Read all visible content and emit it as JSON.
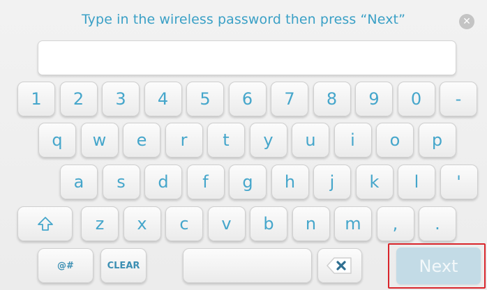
{
  "prompt": "Type in the wireless password then press “Next”",
  "close_icon": "close-icon",
  "password": {
    "value": "",
    "placeholder": ""
  },
  "keys": {
    "row1": [
      "1",
      "2",
      "3",
      "4",
      "5",
      "6",
      "7",
      "8",
      "9",
      "0",
      "-"
    ],
    "row2": [
      "q",
      "w",
      "e",
      "r",
      "t",
      "y",
      "u",
      "i",
      "o",
      "p"
    ],
    "row3": [
      "a",
      "s",
      "d",
      "f",
      "g",
      "h",
      "j",
      "k",
      "l",
      "'"
    ],
    "row4": [
      "z",
      "x",
      "c",
      "v",
      "b",
      "n",
      "m",
      ",",
      "."
    ],
    "symbols_label": "@#",
    "clear_label": "CLEAR",
    "shift_icon": "shift-arrow-icon",
    "backspace_icon": "backspace-icon"
  },
  "next_label": "Next",
  "colors": {
    "accent": "#45a6cb",
    "next_disabled": "#c3dbe6",
    "highlight_border": "#d9252b"
  }
}
